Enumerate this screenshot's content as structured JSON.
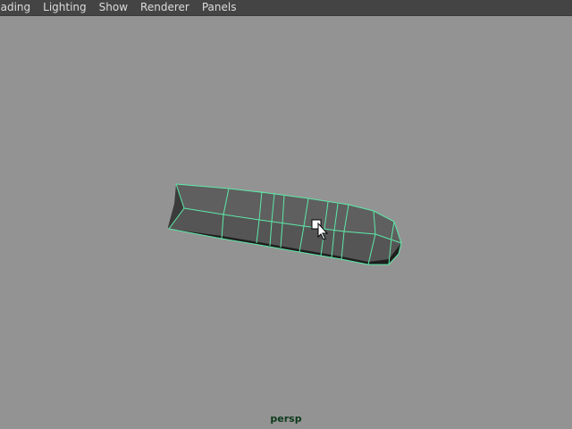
{
  "menubar": {
    "items": [
      "nading",
      "Lighting",
      "Show",
      "Renderer",
      "Panels"
    ]
  },
  "viewport": {
    "camera": "persp",
    "wireframe_color": "#5ee8a8",
    "background_color": "#939393"
  },
  "cursor": {
    "icon": "arrow-pointer-with-select-box-icon"
  }
}
